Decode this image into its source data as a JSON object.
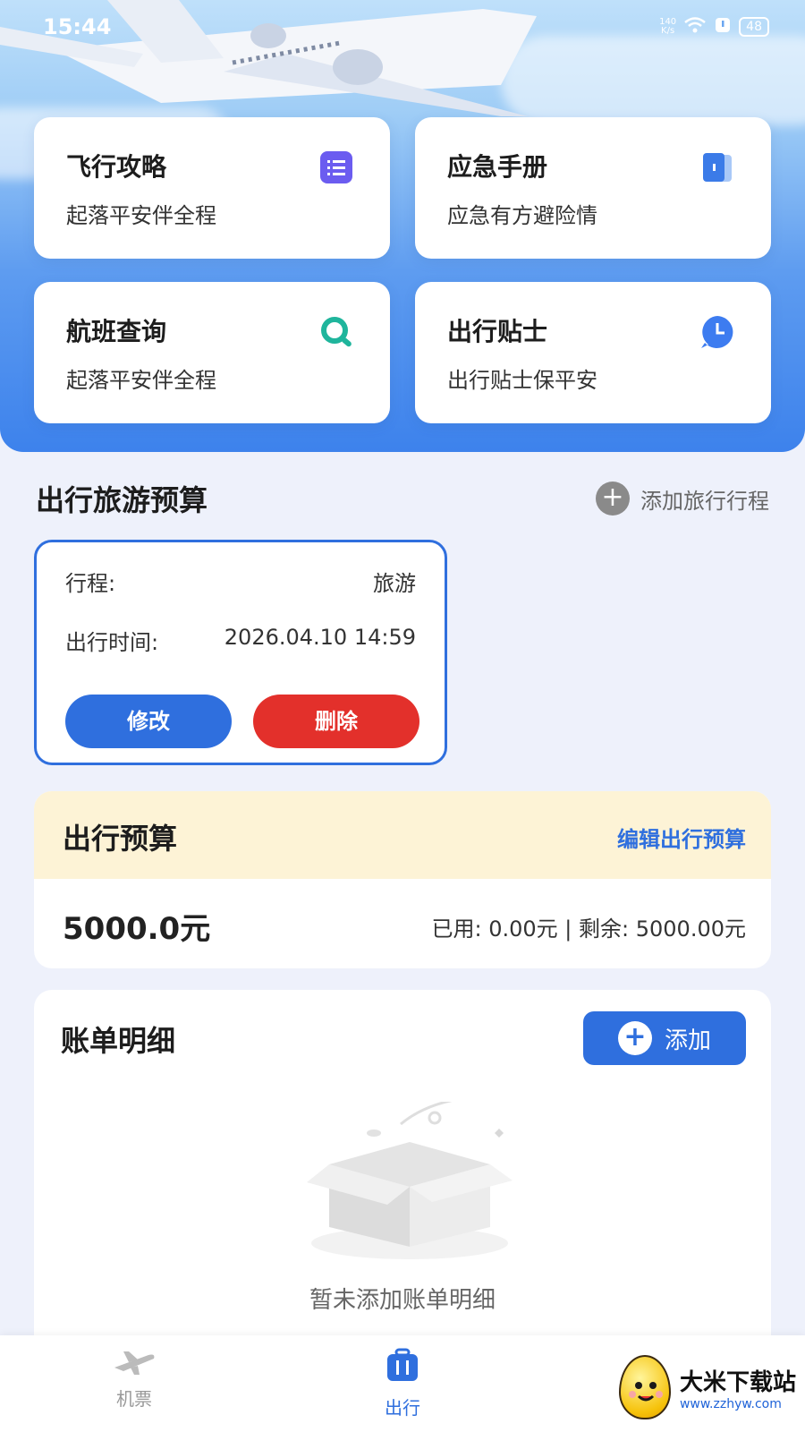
{
  "status_bar": {
    "time": "15:44",
    "network_speed": "140\nK/s",
    "battery": "48"
  },
  "feature_cards": [
    {
      "title": "飞行攻略",
      "subtitle": "起落平安伴全程",
      "icon": "list-icon",
      "icon_color": "#6b5cf0"
    },
    {
      "title": "应急手册",
      "subtitle": "应急有方避险情",
      "icon": "book-icon",
      "icon_color": "#3b7be8"
    },
    {
      "title": "航班查询",
      "subtitle": "起落平安伴全程",
      "icon": "search-icon",
      "icon_color": "#1fb59c"
    },
    {
      "title": "出行贴士",
      "subtitle": "出行贴士保平安",
      "icon": "clock-icon",
      "icon_color": "#3d7cf0"
    }
  ],
  "trip_section": {
    "title": "出行旅游预算",
    "add_label": "添加旅行行程",
    "trip": {
      "route_label": "行程:",
      "route_value": "旅游",
      "time_label": "出行时间:",
      "time_value": "2026.04.10 14:59",
      "edit_label": "修改",
      "delete_label": "删除"
    }
  },
  "budget": {
    "title": "出行预算",
    "edit_label": "编辑出行预算",
    "amount": "5000.0元",
    "usage": "已用: 0.00元 | 剩余: 5000.00元"
  },
  "bill": {
    "title": "账单明细",
    "add_label": "添加",
    "empty_text": "暂未添加账单明细"
  },
  "tabbar": [
    {
      "label": "机票",
      "icon": "plane-icon",
      "active": false
    },
    {
      "label": "出行",
      "icon": "suitcase-icon",
      "active": true
    }
  ],
  "watermark": {
    "name": "大米下载站",
    "url": "www.zzhyw.com"
  },
  "colors": {
    "primary": "#2f6fde",
    "danger": "#e3302b",
    "budget_header": "#fdf3d6"
  }
}
